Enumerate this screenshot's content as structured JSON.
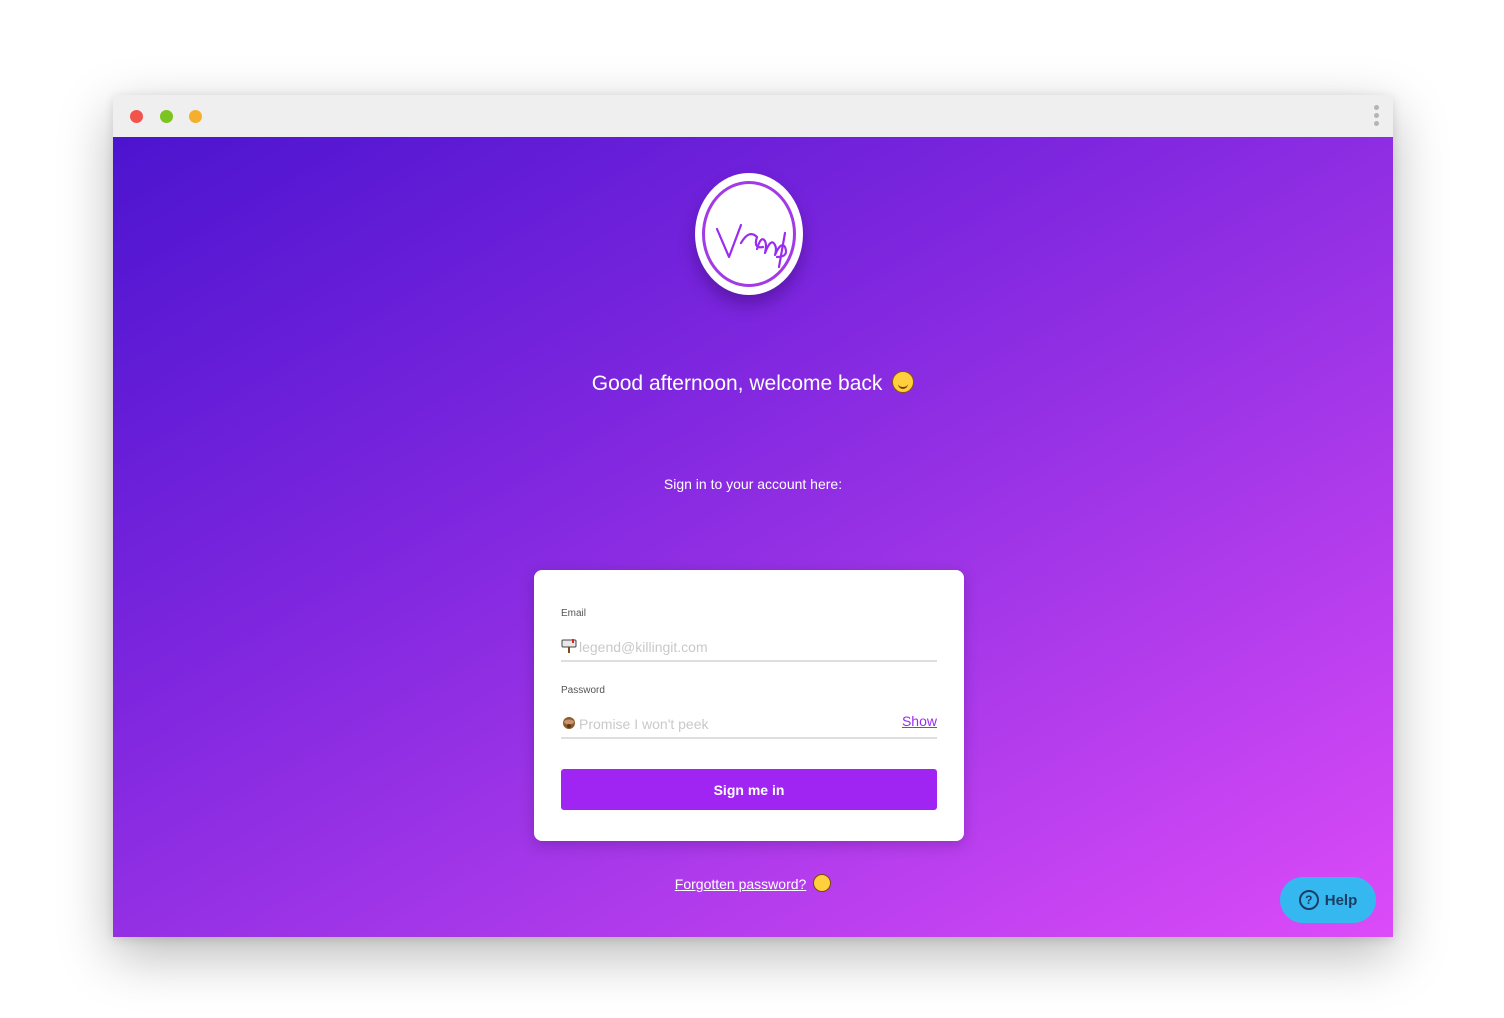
{
  "window": {
    "controls": {
      "close_color": "#f2544d",
      "minimize_color": "#7cc420",
      "zoom_color": "#f4b02d"
    },
    "menu_icon": "kebab-icon"
  },
  "brand": {
    "logo_text": "Vamp",
    "accent_color": "#a024f2"
  },
  "greeting": {
    "text": "Good afternoon, welcome back",
    "emoji_icon": "smiling-face-icon"
  },
  "subtitle": "Sign in to your account here:",
  "form": {
    "email": {
      "label": "Email",
      "placeholder": "legend@killingit.com",
      "value": "",
      "icon": "mailbox-icon"
    },
    "password": {
      "label": "Password",
      "placeholder": "Promise I won't peek",
      "value": "",
      "icon": "see-no-evil-icon",
      "show_label": "Show"
    },
    "submit_label": "Sign me in"
  },
  "forgot_password": {
    "text": "Forgotten password?",
    "emoji_icon": "screaming-face-icon"
  },
  "help": {
    "label": "Help",
    "icon": "question-circle-icon",
    "color": "#35b8f0"
  }
}
